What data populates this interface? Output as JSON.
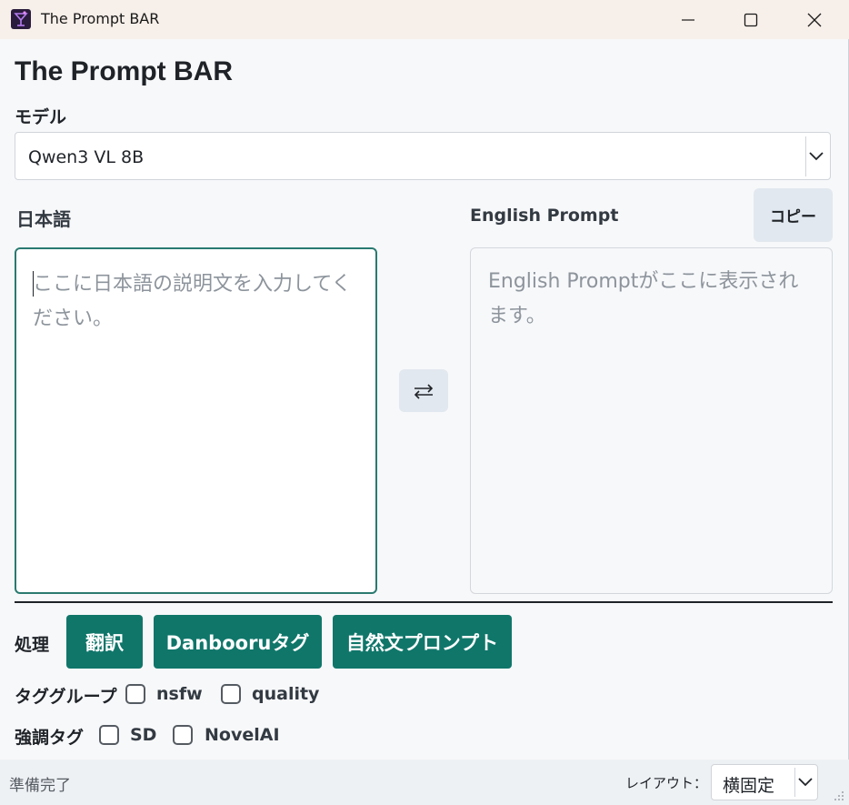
{
  "window": {
    "title": "The Prompt BAR"
  },
  "header": {
    "app_title": "The Prompt BAR"
  },
  "model": {
    "label": "モデル",
    "selected": "Qwen3 VL 8B"
  },
  "japanese": {
    "label": "日本語",
    "placeholder": "ここに日本語の説明文を入力してください。",
    "value": ""
  },
  "english": {
    "label": "English Prompt",
    "copy_label": "コピー",
    "placeholder": "English Promptがここに表示されます。",
    "value": ""
  },
  "swap": {
    "glyph": "⇄"
  },
  "process": {
    "label": "処理",
    "buttons": [
      {
        "label": "翻訳"
      },
      {
        "label": "Danbooruタグ"
      },
      {
        "label": "自然文プロンプト"
      }
    ]
  },
  "tag_group": {
    "label": "タググループ",
    "options": [
      {
        "label": "nsfw",
        "checked": false
      },
      {
        "label": "quality",
        "checked": false
      }
    ]
  },
  "emphasis": {
    "label": "強調タグ",
    "options": [
      {
        "label": "SD",
        "checked": false
      },
      {
        "label": "NovelAI",
        "checked": false
      }
    ]
  },
  "status": {
    "text": "準備完了",
    "layout_label": "レイアウト：",
    "layout_value": "横固定"
  },
  "colors": {
    "accent": "#10766a",
    "focus_border": "#2a7a70",
    "titlebar": "#f7efe9"
  },
  "icons": {
    "app": "cocktail-glass-icon",
    "minimize": "minimize-icon",
    "maximize": "maximize-icon",
    "close": "close-icon",
    "swap": "swap-arrows-icon",
    "dropdown": "chevron-down-icon"
  }
}
